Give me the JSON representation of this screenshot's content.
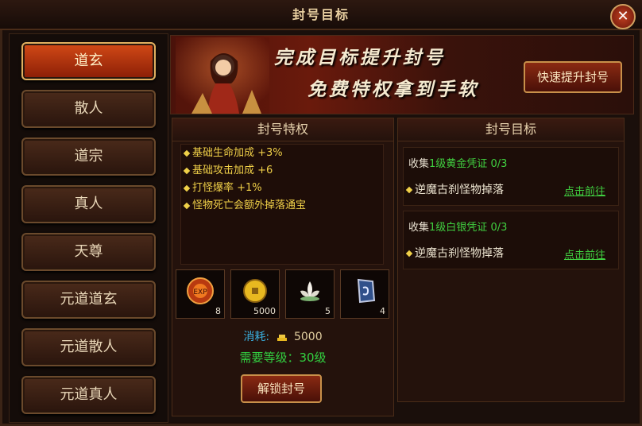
{
  "window": {
    "title": "封号目标",
    "close_label": "✕"
  },
  "sidebar": {
    "items": [
      {
        "label": "道玄",
        "active": true
      },
      {
        "label": "散人",
        "active": false
      },
      {
        "label": "道宗",
        "active": false
      },
      {
        "label": "真人",
        "active": false
      },
      {
        "label": "天尊",
        "active": false
      },
      {
        "label": "元道道玄",
        "active": false
      },
      {
        "label": "元道散人",
        "active": false
      },
      {
        "label": "元道真人",
        "active": false
      }
    ]
  },
  "banner": {
    "line1": "完成目标提升封号",
    "line2": "免费特权拿到手软",
    "quick_button": "快速提升封号"
  },
  "privileges": {
    "title": "封号特权",
    "items": [
      "基础生命加成 +3%",
      "基础攻击加成 +6",
      "打怪爆率 +1%",
      "怪物死亡会额外掉落通宝"
    ]
  },
  "rewards": [
    {
      "icon": "orb-icon",
      "count": "8"
    },
    {
      "icon": "gold-coin-icon",
      "count": "5000"
    },
    {
      "icon": "lotus-icon",
      "count": "5"
    },
    {
      "icon": "rune-stone-icon",
      "count": "4"
    }
  ],
  "cost": {
    "label": "消耗:",
    "value": "5000"
  },
  "level_requirement": "需要等级：30级",
  "unlock_button": "解锁封号",
  "targets": {
    "title": "封号目标",
    "items": [
      {
        "prefix": "收集",
        "item": "1级黄金凭证",
        "progress": "0/3",
        "source": "逆魔古刹怪物掉落",
        "link": "点击前往"
      },
      {
        "prefix": "收集",
        "item": "1级白银凭证",
        "progress": "0/3",
        "source": "逆魔古刹怪物掉落",
        "link": "点击前往"
      }
    ]
  },
  "colors": {
    "accent_gold": "#f0d048",
    "link_green": "#40d040",
    "cost_blue": "#3ab0e0"
  }
}
